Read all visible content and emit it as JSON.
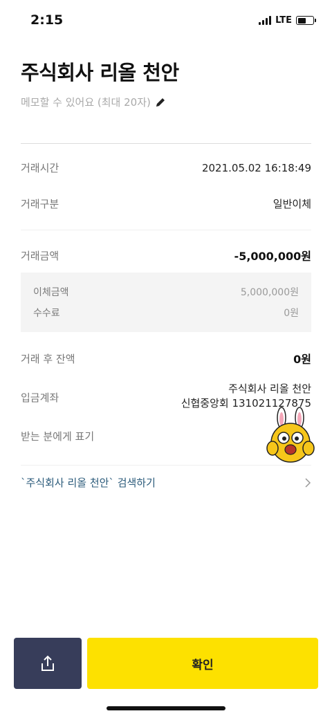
{
  "status_bar": {
    "time": "2:15",
    "network": "LTE",
    "battery_level": 0.55
  },
  "header": {
    "title": "주식회사 리올 천안",
    "memo_placeholder": "메모할 수 있어요 (최대 20자)"
  },
  "details": {
    "time_label": "거래시간",
    "time_value": "2021.05.02 16:18:49",
    "type_label": "거래구분",
    "type_value": "일반이체",
    "amount_label": "거래금액",
    "amount_value": "-5,000,000원",
    "transfer_label": "이체금액",
    "transfer_value": "5,000,000원",
    "fee_label": "수수료",
    "fee_value": "0원",
    "balance_label": "거래 후 잔액",
    "balance_value": "0원",
    "account_label": "입금계좌",
    "account_name": "주식회사 리올 천안",
    "account_number": "신협중앙회 131021127875",
    "recipient_label": "받는 분에게 표기"
  },
  "search_link": {
    "text": "`주식회사 리올 천안` 검색하기"
  },
  "buttons": {
    "confirm_label": "확인"
  },
  "icons": {
    "share": "share-icon",
    "edit": "pencil-icon",
    "chevron": "chevron-right-icon",
    "mascot": "rabbit-mascot-sticker"
  },
  "colors": {
    "confirm": "#fde100",
    "share": "#373d5a",
    "link": "#2a5a7a"
  }
}
